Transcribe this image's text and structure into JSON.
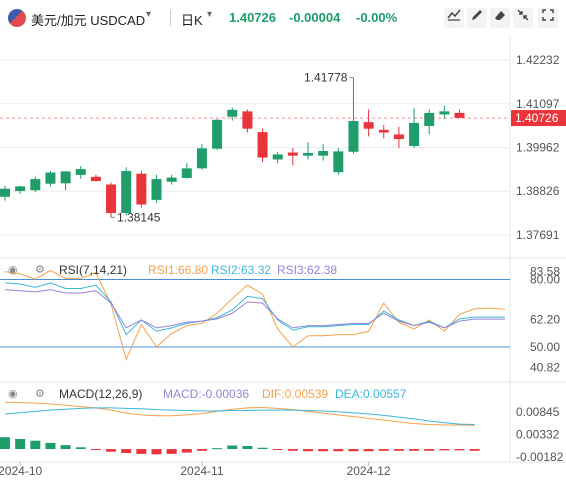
{
  "header": {
    "symbol": "美元/加元 USDCAD",
    "symbol_caret": "▾",
    "timeframe": "日K",
    "timeframe_caret": "▾",
    "price": "1.40726",
    "change": "-0.00004",
    "change_pct": "-0.00%",
    "tools": [
      "chart-type-icon",
      "pencil-icon",
      "eraser-icon",
      "settings-icon",
      "collapse-icon",
      "fullscreen-icon"
    ]
  },
  "chart_data": [
    {
      "type": "candlestick",
      "panel": "price",
      "ylim": [
        1.3735,
        1.4265
      ],
      "y_ticks": [
        1.42232,
        1.41097,
        1.39962,
        1.38826,
        1.37691
      ],
      "y_tick_labels": [
        "1.42232",
        "1.41097",
        "1.39962",
        "1.38826",
        "1.37691"
      ],
      "last_price_label": "1.40726",
      "annotations": [
        {
          "label": "1.41778",
          "value": 1.41778
        },
        {
          "label": "1.38145",
          "value": 1.38145
        }
      ],
      "x_labels": [
        {
          "label": "2024-10",
          "index": 1
        },
        {
          "label": "2024-11",
          "index": 13
        },
        {
          "label": "2024-12",
          "index": 24
        }
      ],
      "candles": [
        {
          "o": 1.3868,
          "h": 1.3897,
          "l": 1.3858,
          "c": 1.3889
        },
        {
          "o": 1.3883,
          "h": 1.3897,
          "l": 1.3875,
          "c": 1.3895
        },
        {
          "o": 1.3885,
          "h": 1.392,
          "l": 1.388,
          "c": 1.3914
        },
        {
          "o": 1.3902,
          "h": 1.3935,
          "l": 1.3895,
          "c": 1.3931
        },
        {
          "o": 1.3903,
          "h": 1.391,
          "l": 1.3885,
          "c": 1.3934
        },
        {
          "o": 1.3925,
          "h": 1.3948,
          "l": 1.3915,
          "c": 1.394
        },
        {
          "o": 1.392,
          "h": 1.3925,
          "l": 1.3908,
          "c": 1.3909
        },
        {
          "o": 1.39,
          "h": 1.3905,
          "l": 1.38145,
          "c": 1.3826
        },
        {
          "o": 1.3826,
          "h": 1.3945,
          "l": 1.382,
          "c": 1.3935
        },
        {
          "o": 1.3928,
          "h": 1.3935,
          "l": 1.384,
          "c": 1.3848
        },
        {
          "o": 1.386,
          "h": 1.3925,
          "l": 1.3852,
          "c": 1.3914
        },
        {
          "o": 1.3907,
          "h": 1.3925,
          "l": 1.39,
          "c": 1.3918
        },
        {
          "o": 1.3917,
          "h": 1.3955,
          "l": 1.3915,
          "c": 1.3942
        },
        {
          "o": 1.3942,
          "h": 1.4005,
          "l": 1.3938,
          "c": 1.3994
        },
        {
          "o": 1.3993,
          "h": 1.407,
          "l": 1.399,
          "c": 1.4068
        },
        {
          "o": 1.4076,
          "h": 1.41,
          "l": 1.4066,
          "c": 1.4094
        },
        {
          "o": 1.409,
          "h": 1.4095,
          "l": 1.4035,
          "c": 1.4045
        },
        {
          "o": 1.4036,
          "h": 1.4045,
          "l": 1.3958,
          "c": 1.397
        },
        {
          "o": 1.3965,
          "h": 1.3985,
          "l": 1.3955,
          "c": 1.3978
        },
        {
          "o": 1.3983,
          "h": 1.3995,
          "l": 1.395,
          "c": 1.3975
        },
        {
          "o": 1.3975,
          "h": 1.401,
          "l": 1.3965,
          "c": 1.3982
        },
        {
          "o": 1.3975,
          "h": 1.4005,
          "l": 1.3962,
          "c": 1.3987
        },
        {
          "o": 1.3932,
          "h": 1.3995,
          "l": 1.3925,
          "c": 1.3986
        },
        {
          "o": 1.3985,
          "h": 1.41778,
          "l": 1.398,
          "c": 1.4065
        },
        {
          "o": 1.4062,
          "h": 1.4095,
          "l": 1.4025,
          "c": 1.4045
        },
        {
          "o": 1.4042,
          "h": 1.4055,
          "l": 1.402,
          "c": 1.4035
        },
        {
          "o": 1.403,
          "h": 1.405,
          "l": 1.3995,
          "c": 1.4018
        },
        {
          "o": 1.4,
          "h": 1.4098,
          "l": 1.3995,
          "c": 1.406
        },
        {
          "o": 1.4052,
          "h": 1.4095,
          "l": 1.403,
          "c": 1.4086
        },
        {
          "o": 1.4082,
          "h": 1.4105,
          "l": 1.407,
          "c": 1.409
        },
        {
          "o": 1.4086,
          "h": 1.4095,
          "l": 1.4075,
          "c": 1.4073
        }
      ]
    },
    {
      "type": "line",
      "panel": "rsi",
      "title": "RSI(7,14,21)",
      "legend": [
        {
          "name": "RSI1",
          "value": "RSI1:66.80",
          "color": "#f5a14a"
        },
        {
          "name": "RSI2",
          "value": "RSI2:63.32",
          "color": "#3cb8d8"
        },
        {
          "name": "RSI3",
          "value": "RSI3:62.38",
          "color": "#9a82d6"
        }
      ],
      "ylim": [
        38,
        86
      ],
      "y_ticks": [
        {
          "label": "80.00",
          "value": 80
        },
        {
          "label": "83.58",
          "value": 83.58
        },
        {
          "label": "62.20",
          "value": 62.2
        },
        {
          "label": "50.00",
          "value": 50
        },
        {
          "label": "40.82",
          "value": 40.82
        }
      ],
      "ref_lines": [
        80,
        50
      ],
      "series": [
        {
          "name": "RSI1",
          "color": "#f5a14a",
          "values": [
            83.5,
            82.5,
            80.2,
            84.0,
            80.5,
            80.5,
            83.0,
            69.0,
            44.5,
            60.0,
            50.0,
            56.0,
            59.5,
            60.5,
            65.0,
            71.5,
            77.5,
            73.5,
            58.0,
            50.0,
            55.0,
            55.0,
            55.5,
            55.5,
            57.0,
            69.5,
            61.0,
            58.0,
            62.0,
            57.0,
            64.5,
            67.0,
            67.3,
            66.8
          ]
        },
        {
          "name": "RSI2",
          "color": "#3cb8d8",
          "values": [
            78.5,
            78.0,
            76.5,
            78.5,
            76.0,
            76.0,
            77.5,
            70.0,
            55.5,
            62.0,
            57.0,
            58.5,
            60.5,
            61.5,
            63.0,
            66.5,
            72.5,
            71.5,
            62.0,
            57.5,
            59.0,
            59.0,
            59.5,
            60.0,
            60.0,
            66.0,
            62.0,
            59.5,
            61.5,
            58.5,
            62.5,
            63.3,
            63.3,
            63.3
          ]
        },
        {
          "name": "RSI3",
          "color": "#9a82d6",
          "values": [
            75.5,
            75.0,
            74.5,
            75.5,
            74.0,
            74.0,
            75.0,
            69.5,
            58.5,
            62.0,
            58.5,
            59.5,
            61.0,
            61.5,
            62.5,
            65.0,
            70.0,
            69.5,
            62.5,
            58.5,
            59.5,
            59.5,
            60.0,
            60.5,
            60.5,
            65.0,
            61.5,
            59.5,
            61.0,
            58.5,
            61.5,
            62.4,
            62.4,
            62.4
          ]
        }
      ]
    },
    {
      "type": "line+bar",
      "panel": "macd",
      "title": "MACD(12,26,9)",
      "legend": [
        {
          "name": "MACD",
          "value": "MACD:-0.00036",
          "color": "#9a82d6"
        },
        {
          "name": "DIF",
          "value": "DIF:0.00539",
          "color": "#f5a14a"
        },
        {
          "name": "DEA",
          "value": "DEA:0.00557",
          "color": "#3cb8d8"
        }
      ],
      "ylim": [
        -0.0025,
        0.0112
      ],
      "y_ticks": [
        {
          "label": "0.00845",
          "value": 0.00845
        },
        {
          "label": "0.00332",
          "value": 0.00332
        },
        {
          "label": "-0.00182",
          "value": -0.00182
        }
      ],
      "series": [
        {
          "name": "DIF",
          "color": "#f5a14a",
          "values": [
            0.0107,
            0.0106,
            0.0105,
            0.0103,
            0.01,
            0.0097,
            0.0094,
            0.0089,
            0.0082,
            0.0078,
            0.0076,
            0.0076,
            0.0078,
            0.0081,
            0.0086,
            0.0091,
            0.0094,
            0.0095,
            0.0093,
            0.009,
            0.0086,
            0.0082,
            0.0078,
            0.0074,
            0.007,
            0.0066,
            0.0062,
            0.0058,
            0.0056,
            0.0055,
            0.0055,
            0.0054
          ]
        },
        {
          "name": "DEA",
          "color": "#3cb8d8",
          "values": [
            0.008,
            0.0083,
            0.0086,
            0.0089,
            0.0091,
            0.0093,
            0.0094,
            0.0094,
            0.0093,
            0.0092,
            0.009,
            0.0089,
            0.0088,
            0.0087,
            0.0087,
            0.0088,
            0.0088,
            0.0089,
            0.0089,
            0.0089,
            0.0088,
            0.0087,
            0.0085,
            0.0083,
            0.008,
            0.0077,
            0.0073,
            0.0069,
            0.0064,
            0.006,
            0.0057,
            0.0056
          ]
        },
        {
          "name": "MACD",
          "type": "bar",
          "values": [
            0.0027,
            0.0023,
            0.0019,
            0.0014,
            0.0009,
            0.0004,
            -0.0002,
            -0.0006,
            -0.0009,
            -0.0011,
            -0.0012,
            -0.0011,
            -0.0008,
            -0.0004,
            0.0002,
            0.0008,
            0.0007,
            0.0003,
            -0.0001,
            -0.0004,
            -0.0005,
            -0.0005,
            -0.0005,
            -0.0005,
            -0.0005,
            -0.0004,
            -0.0004,
            -0.0004,
            -0.0004,
            -0.0003,
            -0.0003,
            -0.0004
          ]
        }
      ]
    }
  ],
  "colors": {
    "up": "#1f9d6b",
    "down": "#e8343a",
    "axis_text": "#555555",
    "grid": "#eeeeee",
    "ref_line": "#4a90d9",
    "price_tag": "#e8343a"
  }
}
